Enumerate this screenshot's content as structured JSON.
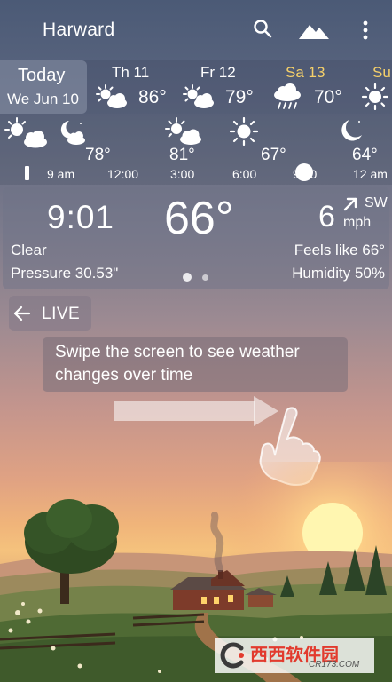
{
  "header": {
    "city": "Harward",
    "icons": [
      "search-icon",
      "landscape-icon",
      "more-vert-icon"
    ]
  },
  "daily": {
    "today_label": "Today",
    "today_date": "We Jun 10",
    "days": [
      {
        "name": "Th 11",
        "temp": "86°",
        "icon": "partly-cloudy-icon"
      },
      {
        "name": "Fr 12",
        "temp": "79°",
        "icon": "partly-cloudy-icon"
      },
      {
        "name": "Sa 13",
        "temp": "70°",
        "icon": "rain-icon",
        "highlight_color": "#f5d06a"
      },
      {
        "name": "Su",
        "temp": "",
        "icon": "sun-icon"
      }
    ]
  },
  "hourly": {
    "temps": [
      "78°",
      "81°",
      "67°",
      "64°"
    ],
    "times": [
      "9 am",
      "12:00",
      "3:00",
      "6:00",
      "9:00",
      "12 am"
    ]
  },
  "current": {
    "time": "9:01",
    "temp": "66°",
    "wind_speed": "6",
    "wind_dir": "SW",
    "wind_unit": "mph",
    "condition": "Clear",
    "pressure": "Pressure 30.53\"",
    "feels_like": "Feels like 66°",
    "humidity": "Humidity 50%"
  },
  "live": {
    "label": "LIVE"
  },
  "tooltip": {
    "line1": "Swipe the screen to see weather",
    "line2": "changes over time"
  },
  "watermark": {
    "text": "西西软件园",
    "sub": "CR173.COM"
  }
}
